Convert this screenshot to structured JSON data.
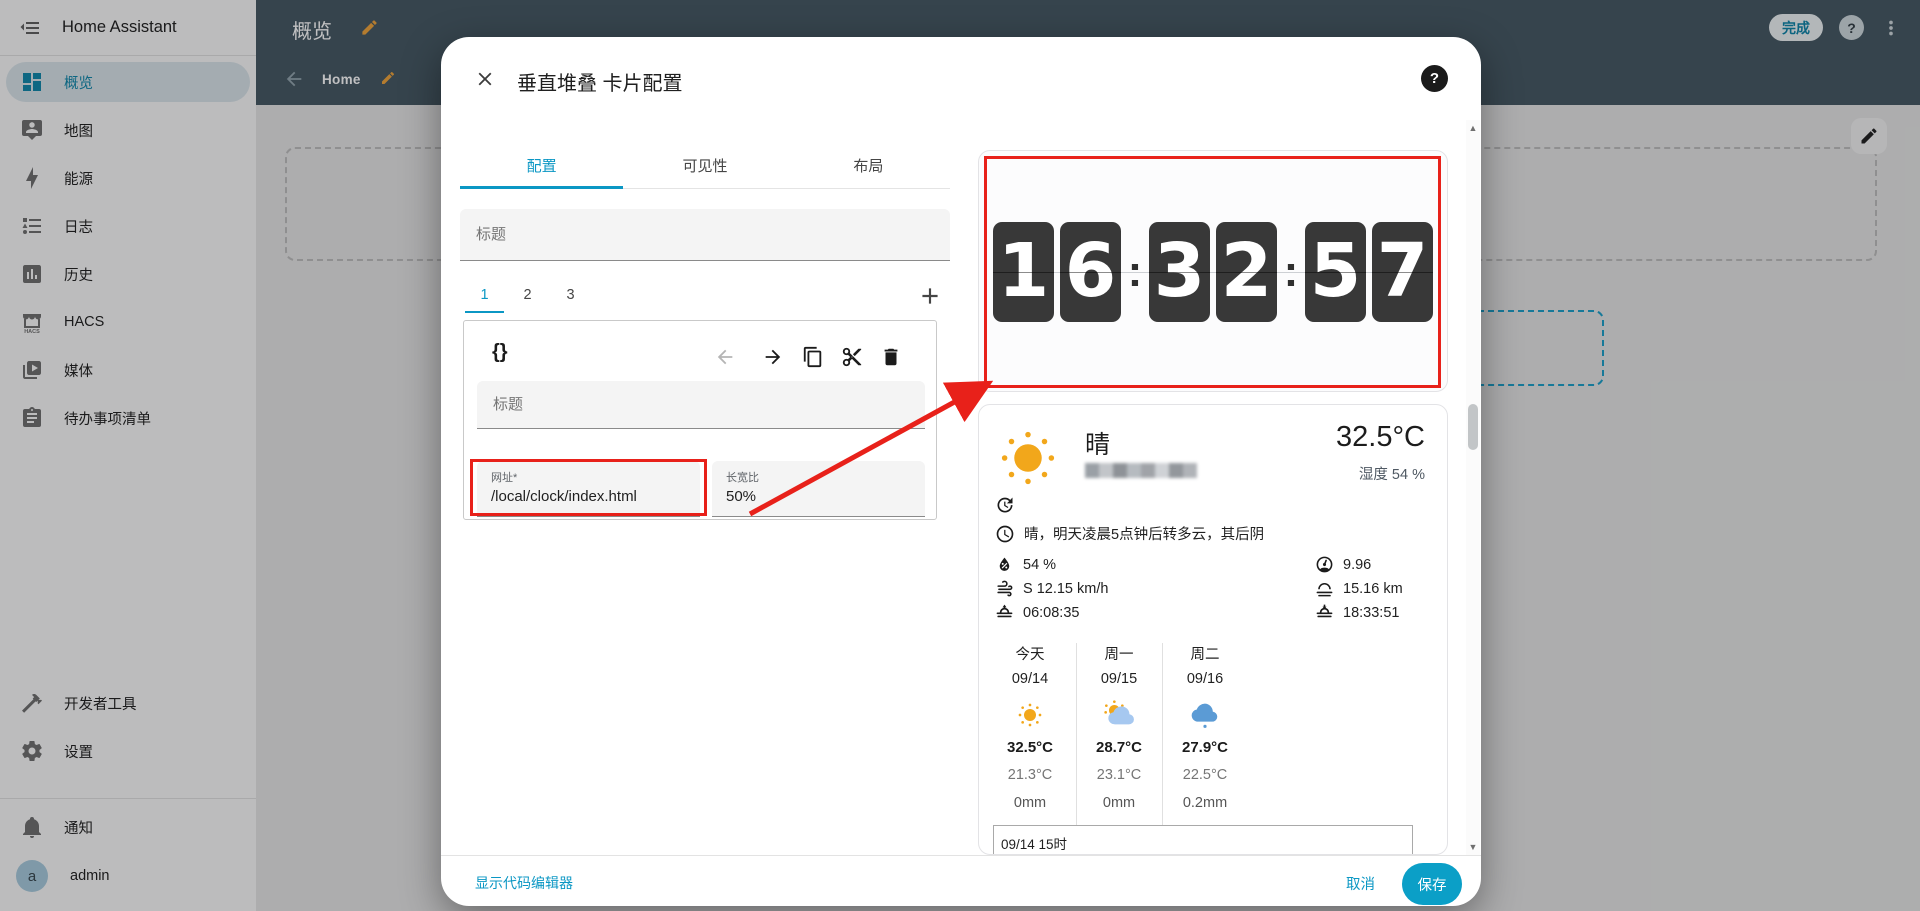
{
  "app": {
    "title": "Home Assistant"
  },
  "topbar": {
    "title": "概览",
    "home_tab": "Home",
    "done": "完成",
    "help": "?"
  },
  "sidebar": {
    "items": [
      {
        "label": "概览",
        "selected": true
      },
      {
        "label": "地图"
      },
      {
        "label": "能源"
      },
      {
        "label": "日志"
      },
      {
        "label": "历史"
      },
      {
        "label": "HACS"
      },
      {
        "label": "媒体"
      },
      {
        "label": "待办事项清单"
      }
    ],
    "dev_tools": "开发者工具",
    "settings": "设置",
    "notifications": "通知",
    "user_name": "admin",
    "avatar_letter": "a"
  },
  "dialog": {
    "title": "垂直堆叠 卡片配置",
    "help": "?",
    "tabs": [
      {
        "label": "配置",
        "active": true
      },
      {
        "label": "可见性"
      },
      {
        "label": "布局"
      }
    ],
    "title_placeholder": "标题",
    "card_tabs": [
      "1",
      "2",
      "3"
    ],
    "editor": {
      "title_placeholder": "标题",
      "url_label": "网址*",
      "url_value": "/local/clock/index.html",
      "aspect_label": "长宽比",
      "aspect_value": "50%"
    },
    "footer": {
      "show_code_editor": "显示代码编辑器",
      "cancel": "取消",
      "save": "保存"
    }
  },
  "preview": {
    "clock": {
      "time": "16:32:57",
      "digits": [
        "1",
        "6",
        "3",
        "2",
        "5",
        "7"
      ],
      "colon": ":"
    },
    "weather": {
      "condition": "晴",
      "temperature": "32.5°C",
      "humidity_line": "湿度 54 %",
      "forecast_text": "晴，明天凌晨5点钟后转多云，其后阴",
      "attributes_left": [
        {
          "icon": "humidity-icon",
          "value": "54 %"
        },
        {
          "icon": "wind-icon",
          "value": "S 12.15 km/h"
        },
        {
          "icon": "sunrise-icon",
          "value": "06:08:35"
        }
      ],
      "attributes_right": [
        {
          "icon": "pressure-gauge-icon",
          "value": "9.96"
        },
        {
          "icon": "visibility-icon",
          "value": "15.16 km"
        },
        {
          "icon": "sunset-icon",
          "value": "18:33:51"
        }
      ],
      "forecast": [
        {
          "day": "今天",
          "date": "09/14",
          "icon": "sunny",
          "high": "32.5°C",
          "low": "21.3°C",
          "precip": "0mm"
        },
        {
          "day": "周一",
          "date": "09/15",
          "icon": "partly-cloudy",
          "high": "28.7°C",
          "low": "23.1°C",
          "precip": "0mm"
        },
        {
          "day": "周二",
          "date": "09/16",
          "icon": "rainy",
          "high": "27.9°C",
          "low": "22.5°C",
          "precip": "0.2mm"
        }
      ],
      "hourly_label": "09/14 15时"
    }
  },
  "colors": {
    "primary": "#0b97c4",
    "annotation": "#e8211a",
    "topbar": "#455863"
  }
}
